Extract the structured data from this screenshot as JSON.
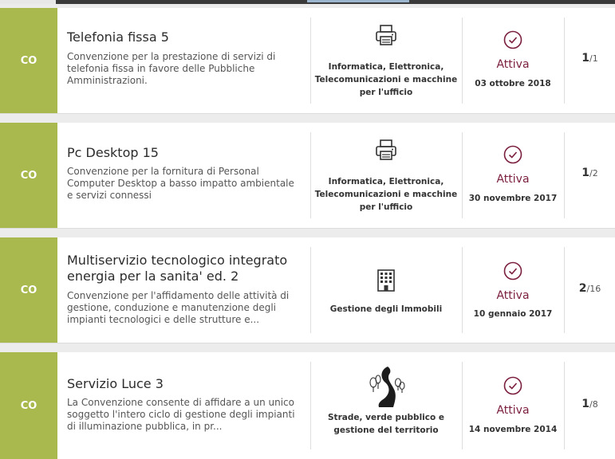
{
  "items": [
    {
      "badge": "CO",
      "title": "Telefonia fissa 5",
      "description": "Convenzione per la prestazione di servizi di telefonia fissa in favore delle Pubbliche Amministrazioni.",
      "category": "Informatica, Elettronica, Telecomunicazioni e macchine per l'ufficio",
      "category_icon": "printer-icon",
      "status": "Attiva",
      "date": "03 ottobre 2018",
      "lot_current": "1",
      "lot_total": "/1"
    },
    {
      "badge": "CO",
      "title": "Pc Desktop 15",
      "description": "Convenzione per la fornitura di Personal Computer Desktop a basso impatto ambientale e servizi connessi",
      "category": "Informatica, Elettronica, Telecomunicazioni e macchine per l'ufficio",
      "category_icon": "printer-icon",
      "status": "Attiva",
      "date": "30 novembre 2017",
      "lot_current": "1",
      "lot_total": "/2"
    },
    {
      "badge": "CO",
      "title": "Multiservizio tecnologico integrato energia per la sanita' ed. 2",
      "description": "Convenzione per l'affidamento delle attività di gestione, conduzione e manutenzione degli impianti tecnologici e delle strutture e...",
      "category": "Gestione degli Immobili",
      "category_icon": "building-icon",
      "status": "Attiva",
      "date": "10 gennaio 2017",
      "lot_current": "2",
      "lot_total": "/16"
    },
    {
      "badge": "CO",
      "title": "Servizio Luce 3",
      "description": "La Convenzione consente di affidare a un unico soggetto l'intero ciclo di gestione degli impianti di illuminazione pubblica, in pr...",
      "category": "Strade, verde pubblico e gestione del territorio",
      "category_icon": "road-trees-icon",
      "status": "Attiva",
      "date": "14 novembre 2014",
      "lot_current": "1",
      "lot_total": "/8"
    }
  ],
  "colors": {
    "badge": "#a9b94e",
    "status": "#7a1e3c"
  }
}
